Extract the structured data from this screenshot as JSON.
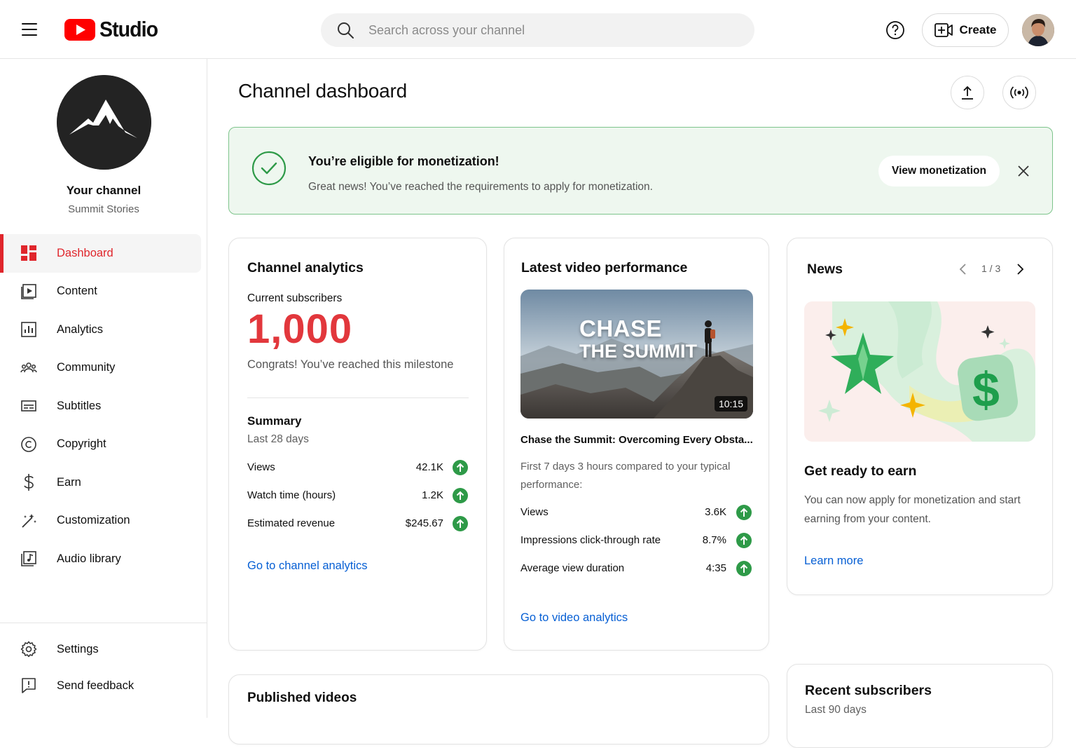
{
  "app": {
    "logo_text": "Studio",
    "brand_color": "#ff0000"
  },
  "search": {
    "placeholder": "Search across your channel"
  },
  "header": {
    "create_label": "Create"
  },
  "channel": {
    "title": "Your channel",
    "name": "Summit Stories"
  },
  "sidebar": {
    "items": [
      {
        "label": "Dashboard",
        "icon": "dashboard-icon",
        "active": true
      },
      {
        "label": "Content",
        "icon": "content-icon"
      },
      {
        "label": "Analytics",
        "icon": "analytics-icon"
      },
      {
        "label": "Community",
        "icon": "community-icon"
      },
      {
        "label": "Subtitles",
        "icon": "subtitles-icon"
      },
      {
        "label": "Copyright",
        "icon": "copyright-icon"
      },
      {
        "label": "Earn",
        "icon": "dollar-icon"
      },
      {
        "label": "Customization",
        "icon": "magic-wand-icon"
      },
      {
        "label": "Audio library",
        "icon": "audio-library-icon"
      }
    ],
    "bottom": [
      {
        "label": "Settings",
        "icon": "gear-icon"
      },
      {
        "label": "Send feedback",
        "icon": "feedback-icon"
      }
    ]
  },
  "page": {
    "title": "Channel dashboard"
  },
  "banner": {
    "title": "You’re eligible for monetization!",
    "text": "Great news! You’ve reached the requirements to apply for monetization.",
    "button": "View monetization"
  },
  "analytics": {
    "title": "Channel analytics",
    "subs_label": "Current subscribers",
    "subs_value": "1,000",
    "milestone": "Congrats! You’ve reached this milestone",
    "summary_title": "Summary",
    "summary_period": "Last 28 days",
    "rows": [
      {
        "label": "Views",
        "value": "42.1K"
      },
      {
        "label": "Watch time (hours)",
        "value": "1.2K"
      },
      {
        "label": "Estimated revenue",
        "value": "$245.67"
      }
    ],
    "link": "Go to channel analytics"
  },
  "video": {
    "title": "Latest video performance",
    "thumb_line1": "CHASE",
    "thumb_line2": "THE SUMMIT",
    "duration": "10:15",
    "video_title": "Chase the Summit: Overcoming Every Obsta...",
    "desc": "First 7 days 3 hours compared to your typical performance:",
    "rows": [
      {
        "label": "Views",
        "value": "3.6K"
      },
      {
        "label": "Impressions click-through rate",
        "value": "8.7%"
      },
      {
        "label": "Average view duration",
        "value": "4:35"
      }
    ],
    "link": "Go to video analytics"
  },
  "news": {
    "title": "News",
    "pager": "1 / 3",
    "heading": "Get ready to earn",
    "text": "You can now apply for monetization and start earning from your content.",
    "link": "Learn more"
  },
  "published": {
    "title": "Published videos"
  },
  "recent": {
    "title": "Recent subscribers",
    "period": "Last 90 days"
  },
  "colors": {
    "accent_red": "#e0262c",
    "success_green": "#2e9a48",
    "link_blue": "#065fd4"
  }
}
